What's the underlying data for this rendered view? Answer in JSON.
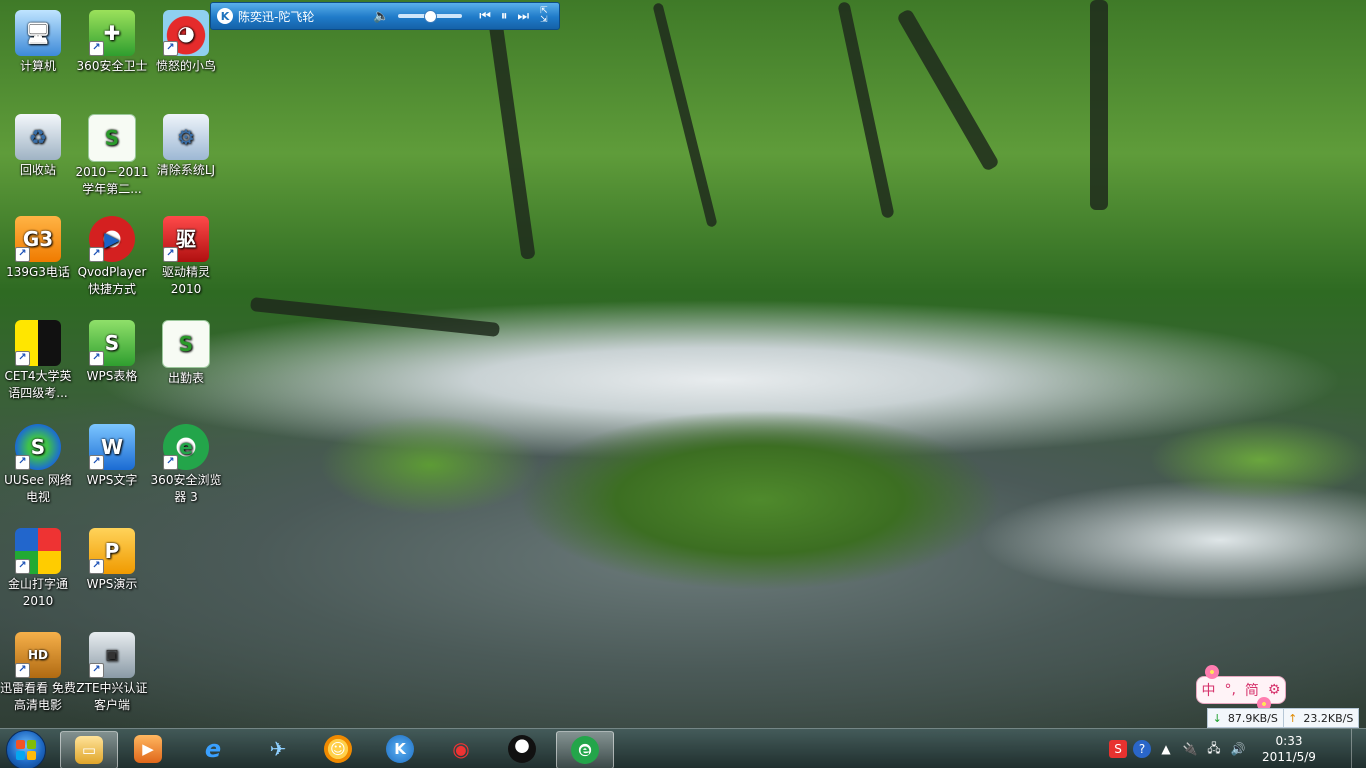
{
  "desktop_icons": [
    {
      "label": "计算机",
      "icon": "computer-icon"
    },
    {
      "label": "360安全卫士",
      "icon": "360-safeguard-icon"
    },
    {
      "label": "愤怒的小鸟",
      "icon": "angry-birds-icon"
    },
    {
      "label": "回收站",
      "icon": "recycle-bin-icon"
    },
    {
      "label": "2010－2011学年第二...",
      "icon": "spreadsheet-file-icon"
    },
    {
      "label": "清除系统LJ",
      "icon": "gear-icon"
    },
    {
      "label": "139G3电话",
      "icon": "139-phone-icon"
    },
    {
      "label": "QvodPlayer快捷方式",
      "icon": "qvod-player-icon"
    },
    {
      "label": "驱动精灵2010",
      "icon": "driver-genius-icon"
    },
    {
      "label": "CET4大学英语四级考...",
      "icon": "cet4-icon"
    },
    {
      "label": "WPS表格",
      "icon": "wps-spreadsheet-icon"
    },
    {
      "label": "出勤表",
      "icon": "spreadsheet-file-icon"
    },
    {
      "label": "UUSee 网络电视",
      "icon": "uusee-icon"
    },
    {
      "label": "WPS文字",
      "icon": "wps-writer-icon"
    },
    {
      "label": "360安全浏览器 3",
      "icon": "360-browser-icon"
    },
    {
      "label": "金山打字通2010",
      "icon": "typing-icon"
    },
    {
      "label": "WPS演示",
      "icon": "wps-presentation-icon"
    },
    {
      "label": "迅雷看看 免费高清电影",
      "icon": "xunlei-hd-icon"
    },
    {
      "label": "ZTE中兴认证客户端",
      "icon": "zte-client-icon"
    }
  ],
  "player": {
    "title": "陈奕迅-陀飞轮",
    "logo_letter": "K",
    "volume": 0.4,
    "controls": [
      "prev",
      "pause",
      "next"
    ]
  },
  "ime": {
    "label_zhong": "中",
    "label_punct": "°,",
    "label_jian": "简",
    "gear": "⚙"
  },
  "netspeed": {
    "down": "87.9KB/S",
    "up": "23.2KB/S"
  },
  "taskbar": {
    "apps": [
      {
        "name": "explorer",
        "icon": "folder-icon",
        "active": true
      },
      {
        "name": "media-player",
        "icon": "media-player-icon",
        "active": false
      },
      {
        "name": "ie",
        "icon": "ie-icon",
        "active": false
      },
      {
        "name": "feixin",
        "icon": "plane-icon",
        "active": false
      },
      {
        "name": "chat",
        "icon": "chat-bubbles-icon",
        "active": false
      },
      {
        "name": "kugou",
        "icon": "kugou-icon",
        "active": false
      },
      {
        "name": "weibo",
        "icon": "weibo-icon",
        "active": false
      },
      {
        "name": "qq",
        "icon": "qq-penguin-icon",
        "active": false
      },
      {
        "name": "360-browser",
        "icon": "360-browser-icon",
        "active": true
      }
    ],
    "clock_time": "0:33",
    "clock_date": "2011/5/9"
  },
  "colors": {
    "player_blue": "#1f7ac8",
    "ime_pink": "#d6336c",
    "down_green": "#1d9f2c",
    "up_orange": "#e08a00"
  }
}
